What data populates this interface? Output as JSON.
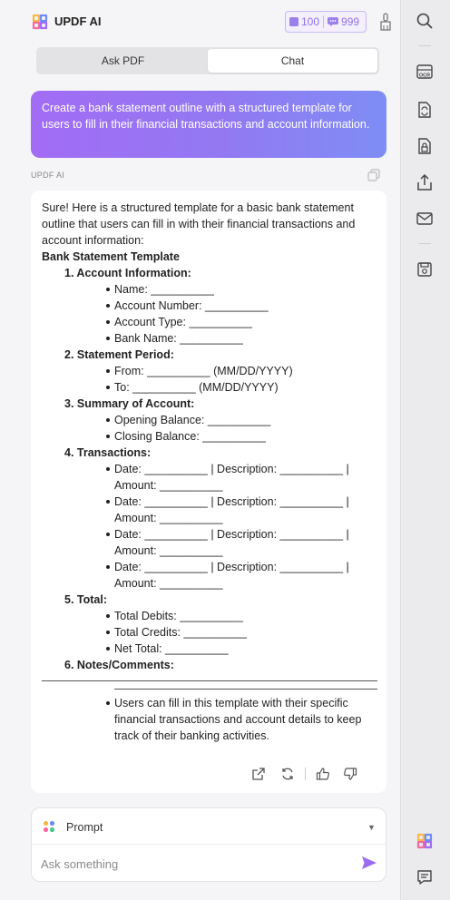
{
  "header": {
    "app_title": "UPDF AI",
    "credits_a": "100",
    "credits_b": "999"
  },
  "tabs": [
    {
      "label": "Ask PDF",
      "active": false
    },
    {
      "label": "Chat",
      "active": true
    }
  ],
  "user_message": "Create a bank statement outline with  a structured template for users to fill in their financial transactions and account information.",
  "ai_label": "UPDF AI",
  "ai_response": {
    "intro": "Sure! Here is a structured template for a basic bank statement outline that users can fill in with their financial transactions and account information:",
    "heading": "Bank Statement Template",
    "sections": [
      {
        "title": "1. Account Information:",
        "items": [
          "Name: __________",
          "Account Number: __________",
          "Account Type: __________",
          "Bank Name: __________"
        ]
      },
      {
        "title": "2. Statement Period:",
        "items": [
          "From: __________ (MM/DD/YYYY)",
          "To: __________ (MM/DD/YYYY)"
        ]
      },
      {
        "title": "3. Summary of Account:",
        "items": [
          "Opening Balance: __________",
          "Closing Balance: __________"
        ]
      },
      {
        "title": "4. Transactions:",
        "items": [
          "Date: __________ | Description: __________ | Amount: __________",
          "Date: __________ | Description: __________ | Amount: __________",
          "Date: __________ | Description: __________ | Amount: __________",
          "Date: __________ | Description: __________ | Amount: __________"
        ]
      },
      {
        "title": "5. Total:",
        "items": [
          "Total Debits: __________",
          "Total Credits: __________",
          "Net Total: __________"
        ]
      },
      {
        "title": "6. Notes/Comments:",
        "items": []
      }
    ],
    "tail_items": [
      "Users can fill in this template with their specific financial transactions and account details to keep track of their banking activities."
    ]
  },
  "prompt": {
    "label": "Prompt",
    "placeholder": "Ask something"
  },
  "colors": {
    "accent": "#9b6cf2",
    "gradient_start": "#a26cf4",
    "gradient_end": "#7f8df5"
  },
  "icons": {
    "rail": [
      "search-icon",
      "ocr-icon",
      "convert-icon",
      "protect-icon",
      "share-icon",
      "mail-icon",
      "save-icon",
      "updf-ai-icon",
      "comment-icon"
    ]
  }
}
